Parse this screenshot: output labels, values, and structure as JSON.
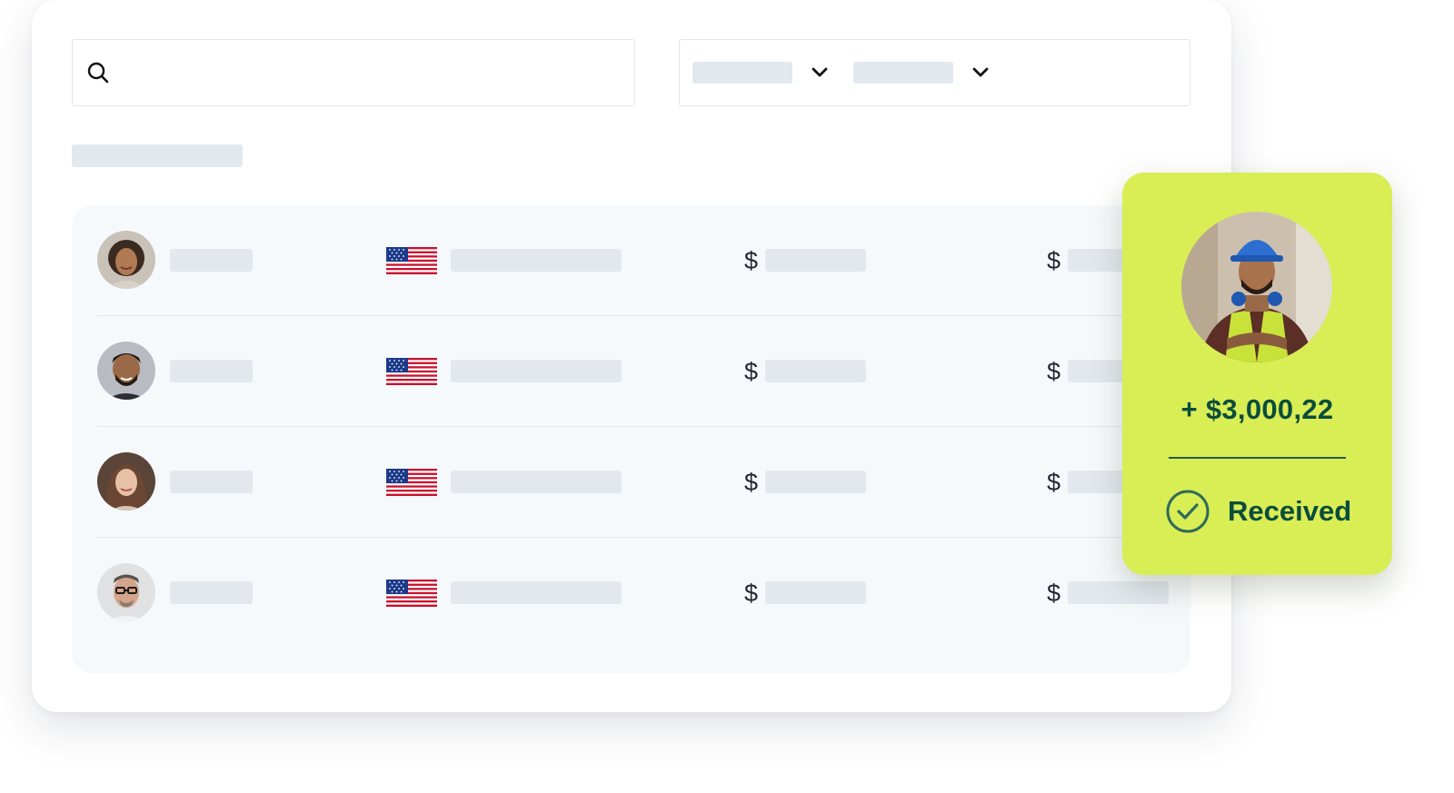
{
  "search": {
    "icon": "search-icon",
    "value": ""
  },
  "filters": [
    {
      "name": "filter-1",
      "value": "",
      "icon": "chevron-down-icon"
    },
    {
      "name": "filter-2",
      "value": "",
      "icon": "chevron-down-icon"
    }
  ],
  "table": {
    "rows": [
      {
        "avatar": "avatar-woman-curly-hair",
        "flag": "us-flag",
        "currency_1": "$",
        "currency_2": "$"
      },
      {
        "avatar": "avatar-man-beard",
        "flag": "us-flag",
        "currency_1": "$",
        "currency_2": "$"
      },
      {
        "avatar": "avatar-woman-brown-hair",
        "flag": "us-flag",
        "currency_1": "$",
        "currency_2": "$"
      },
      {
        "avatar": "avatar-man-glasses",
        "flag": "us-flag",
        "currency_1": "$",
        "currency_2": "$"
      }
    ]
  },
  "notification": {
    "avatar": "avatar-construction-worker",
    "amount": "+ $3,000,22",
    "status": "Received",
    "status_icon": "check-circle-icon",
    "background": "#d9ed55",
    "text_color": "#0b4d3c"
  }
}
